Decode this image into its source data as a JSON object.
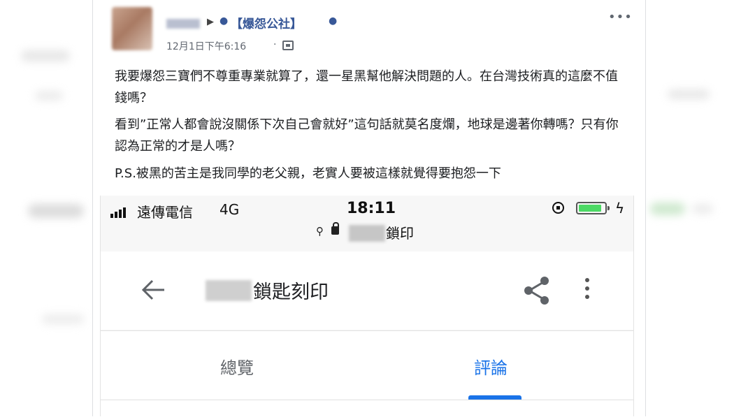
{
  "post": {
    "group_name": "【爆怨公社】",
    "timestamp": "12月1日下午6:16",
    "separator": "·",
    "paragraphs": [
      "我要爆怨三寶們不尊重專業就算了，還一星黑幫他解決問題的人。在台灣技術真的這麼不值錢嗎？",
      "看到”正常人都會說沒關係下次自己會就好”這句話就莫名度爛，地球是邊著你轉嗎？只有你認為正常的才是人嗎？",
      "P.S.被黑的苦主是我同學的老父親，老實人要被這樣就覺得要抱怨一下"
    ],
    "more_icon": "more-horizontal-icon",
    "privacy_icon": "group-privacy-icon"
  },
  "phone": {
    "status": {
      "carrier": "遠傳電信",
      "network": "4G",
      "time": "18:11"
    },
    "url_suffix": "鎖印",
    "app_title_suffix": "鎖匙刻印",
    "tabs": [
      {
        "label": "總覽",
        "active": false
      },
      {
        "label": "評論",
        "active": true
      }
    ],
    "accent_color": "#1a73e8",
    "battery_color": "#4cd964"
  },
  "colors": {
    "link_blue": "#385898",
    "text": "#1c1e21",
    "meta": "#616770"
  }
}
